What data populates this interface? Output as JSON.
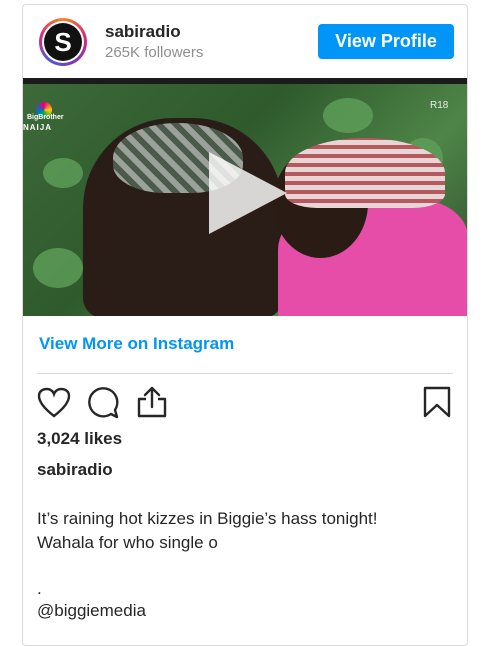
{
  "profile": {
    "username": "sabiradio",
    "followers": "265K followers",
    "avatar_letter": "S",
    "view_profile_label": "View Profile"
  },
  "media": {
    "logo_line": "BigBrother",
    "logo_naija": "NAIJA",
    "rating": "R18",
    "play_icon": "play-icon"
  },
  "view_more_label": "View More on Instagram",
  "actions": {
    "like_icon": "heart-icon",
    "comment_icon": "comment-icon",
    "share_icon": "share-icon",
    "save_icon": "bookmark-icon"
  },
  "likes": "3,024 likes",
  "caption": {
    "user": "sabiradio",
    "text": "It’s raining hot kizzes in Biggie’s hass tonight!\nWahala for who single o",
    "dot": ".",
    "more": "@biggiemedia"
  },
  "colors": {
    "accent": "#0095f6",
    "text": "#262626",
    "muted": "#8e8e8e",
    "border": "#dbdbdb"
  }
}
